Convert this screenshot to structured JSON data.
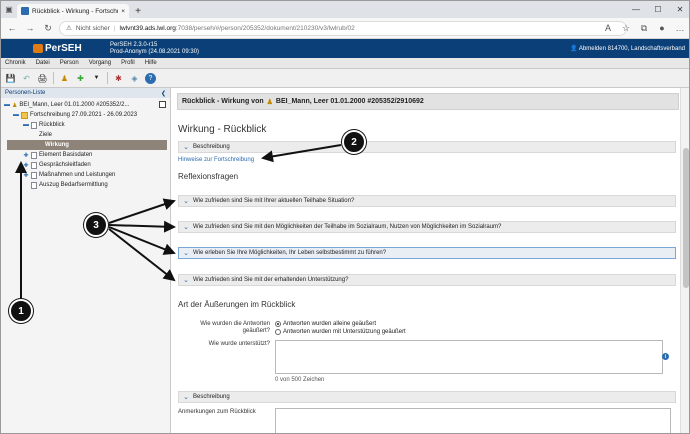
{
  "browser": {
    "tab_title": "Rückblick - Wirkung - Fortschrei",
    "close": "×",
    "newtab": "+",
    "security": "Nicht sicher",
    "url_domain": "lwlvnt39.ads.lwl.org",
    "url_path": ":7038/perseh/#/person/205352/dokument/210230/v3/lwlrub/02"
  },
  "app": {
    "logo": "PerSEH",
    "version": "PerSEH 2.3.0-r15",
    "env": "Prod-Anonym (24.08.2021 09:30)",
    "logout": "Abmelden 814700, Landschaftsverband",
    "menu": [
      "Chronik",
      "Datei",
      "Person",
      "Vorgang",
      "Profil",
      "Hilfe"
    ]
  },
  "sidebar": {
    "title": "Personen-Liste",
    "items": [
      {
        "label": "BEI_Mann, Leer 01.01.2000 #205352/2..."
      },
      {
        "label": "Fortschreibung 27.09.2021 - 26.09.2023"
      },
      {
        "label": "Rückblick"
      },
      {
        "label": "Ziele"
      },
      {
        "label": "Wirkung"
      },
      {
        "label": "Element Basisdaten"
      },
      {
        "label": "Gesprächsleitfaden"
      },
      {
        "label": "Maßnahmen und Leistungen"
      },
      {
        "label": "Auszug Bedarfsermittlung"
      }
    ]
  },
  "main": {
    "titlebar": "Rückblick - Wirkung von",
    "titlebar_person": "BEI_Mann, Leer 01.01.2000 #205352/2910692",
    "heading": "Wirkung - Rückblick",
    "beschreibung": "Beschreibung",
    "hinweise_link": "Hinweise zur Fortschreibung",
    "reflexion_heading": "Reflexionsfragen",
    "questions": [
      "Wie zufrieden sind Sie mit Ihrer aktuellen Teilhabe Situation?",
      "Wie zufrieden sind Sie mit den Möglichkeiten der Teilhabe im Sozialraum, Nutzen von Möglichkeiten im Sozialraum?",
      "Wie erleben Sie Ihre Möglichkeiten, Ihr Leben selbstbestimmt zu führen?",
      "Wie zufrieden sind Sie mit der erhaltenden Unterstützung?"
    ],
    "art_heading": "Art der Äußerungen im Rückblick",
    "antworten_label_1": "Wie wurden die Antworten",
    "antworten_label_2": "geäußert?",
    "radio_alone": "Antworten wurden alleine geäußert",
    "radio_support": "Antworten wurden mit Unterstützung geäußert",
    "unterstuetzt_label": "Wie wurde unterstützt?",
    "counter": "0 von 500 Zeichen",
    "beschreibung2": "Beschreibung",
    "anmerkungen_label": "Anmerkungen zum Rückblick"
  },
  "callouts": {
    "one": "1",
    "two": "2",
    "three": "3"
  }
}
